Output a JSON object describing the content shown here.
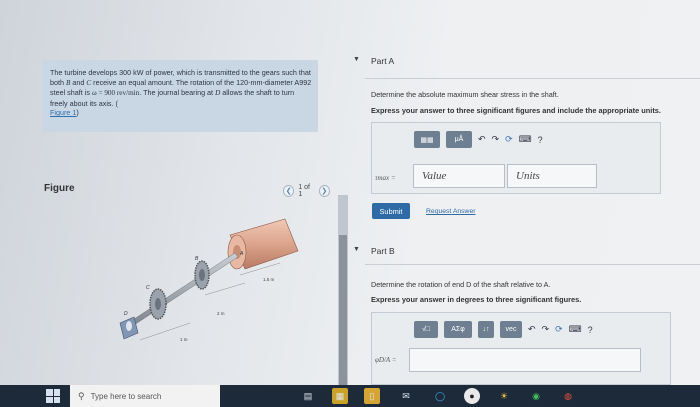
{
  "problem": {
    "text_1": "The turbine develops 300 kW of power, which is transmitted to the gears such that both ",
    "gear_b": "B",
    "text_2": " and ",
    "gear_c": "C",
    "text_3": " receive an equal amount. The rotation of the 120-mm-diameter A992 steel shaft is ",
    "omega": "ω = 900 rev/min",
    "text_4": ". The journal bearing at ",
    "bearing_d": "D",
    "text_5": " allows the shaft to turn freely about its axis. (",
    "figure_link": "Figure 1",
    "text_6": ")"
  },
  "figure": {
    "label": "Figure",
    "pager": "1 of 1",
    "labels": {
      "a": "A",
      "b": "B",
      "c": "C",
      "d": "D",
      "dim1": "1.5 m",
      "dim2": "2 m",
      "dim3": "1 m"
    }
  },
  "part_a": {
    "title": "Part A",
    "question": "Determine the absolute maximum shear stress in the shaft.",
    "instruction": "Express your answer to three significant figures and include the appropriate units.",
    "symbol": "τmax =",
    "value_placeholder": "Value",
    "units_placeholder": "Units",
    "toolbar_mu": "μÅ",
    "submit": "Submit",
    "request_answer": "Request Answer"
  },
  "part_b": {
    "title": "Part B",
    "question": "Determine the rotation of end D of the shaft relative to A.",
    "instruction": "Express your answer in degrees to three significant figures.",
    "symbol": "φD/A =",
    "toolbar_sqrt": "√□",
    "toolbar_greek": "ΑΣφ",
    "toolbar_sort": "↓↑",
    "toolbar_vec": "vec"
  },
  "taskbar": {
    "search_placeholder": "Type here to search"
  },
  "colors": {
    "problem_bg": "#c9d7e4",
    "toolbar_btn": "#6d7f91",
    "submit_bg": "#2d6aa6",
    "link": "#2e6fb0",
    "taskbar": "#1d2a3a"
  }
}
